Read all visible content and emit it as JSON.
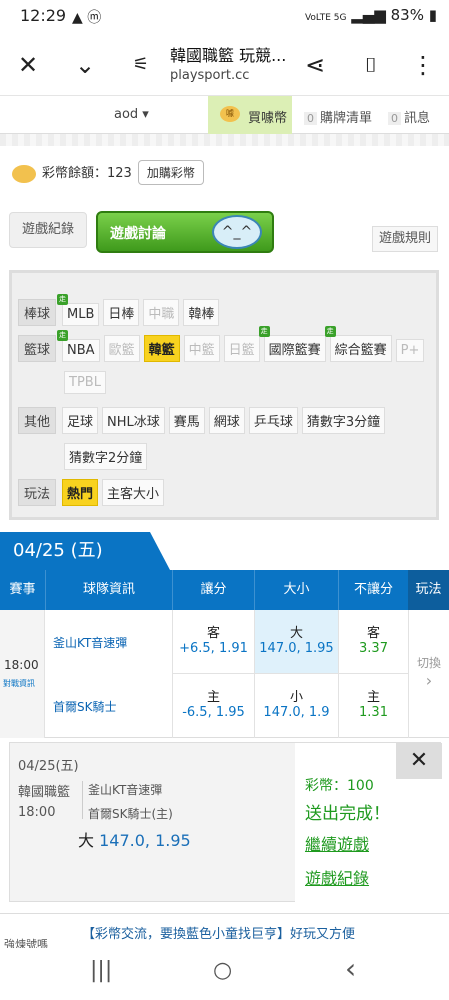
{
  "status": {
    "time": "12:29",
    "icons": "▲ ⓜ",
    "net": "VoLTE 5G",
    "battery": "83%"
  },
  "browser": {
    "title": "韓國職籃 玩競...",
    "url": "playsport.cc"
  },
  "nav": {
    "user": "aod ▾",
    "buy_label": "買噱幣",
    "buy_coin": "噱",
    "cart_count": "0",
    "cart_label": "購牌清單",
    "msg_count": "0",
    "msg_label": "訊息"
  },
  "balance": {
    "label": "彩幣餘額：123",
    "add_label": "加購彩幣"
  },
  "tabs": {
    "record": "遊戲紀錄",
    "discuss": "遊戲討論",
    "rules": "遊戲規則"
  },
  "filters": {
    "baseball": {
      "cat": "棒球",
      "items": [
        {
          "label": "MLB",
          "walk": true
        },
        {
          "label": "日棒"
        },
        {
          "label": "中職",
          "dim": true
        },
        {
          "label": "韓棒"
        }
      ]
    },
    "basketball": {
      "cat": "籃球",
      "items": [
        {
          "label": "NBA",
          "walk": true
        },
        {
          "label": "歐籃",
          "dim": true
        },
        {
          "label": "韓籃",
          "active": true
        },
        {
          "label": "中籃",
          "dim": true
        },
        {
          "label": "日籃",
          "dim": true
        },
        {
          "label": "國際籃賽",
          "walk": true
        },
        {
          "label": "綜合籃賽",
          "walk": true
        },
        {
          "label": "P+",
          "dim": true
        }
      ],
      "row2": [
        {
          "label": "TPBL",
          "dim": true
        }
      ]
    },
    "other": {
      "cat": "其他",
      "items": [
        {
          "label": "足球"
        },
        {
          "label": "NHL冰球"
        },
        {
          "label": "賽馬"
        },
        {
          "label": "網球"
        },
        {
          "label": "乒乓球"
        },
        {
          "label": "猜數字3分鐘"
        }
      ],
      "row2": [
        {
          "label": "猜數字2分鐘"
        }
      ]
    },
    "play": {
      "cat": "玩法",
      "items": [
        {
          "label": "熱門",
          "active": true
        },
        {
          "label": "主客大小"
        }
      ]
    },
    "walk_glyph": "走"
  },
  "date": "04/25 (五)",
  "table": {
    "headers": {
      "event": "賽事",
      "team": "球隊資訊",
      "spread": "讓分",
      "total": "大小",
      "moneyline": "不讓分",
      "play": "玩法"
    },
    "time": "18:00",
    "info": "對戰資訊",
    "away": {
      "team": "釜山KT音速彈",
      "spread_k": "客",
      "spread_v": "+6.5, 1.91",
      "total_k": "大",
      "total_v": "147.0, 1.95",
      "ml_k": "客",
      "ml_v": "3.37"
    },
    "home": {
      "team": "首爾SK騎士",
      "spread_k": "主",
      "spread_v": "-6.5, 1.95",
      "total_k": "小",
      "total_v": "147.0, 1.9",
      "ml_k": "主",
      "ml_v": "1.31"
    },
    "switch": "切換",
    "switch_arrow": "›"
  },
  "popup": {
    "date": "04/25(五)",
    "league": "韓國職籃",
    "time": "18:00",
    "away": "釜山KT音速彈",
    "home": "首爾SK騎士(主)",
    "bet_k": "大",
    "bet_v": "147.0, 1.95",
    "coins": "彩幣：100",
    "done": "送出完成！",
    "continue": "繼續遊戲",
    "record": "遊戲紀錄",
    "close": "✕"
  },
  "banner": {
    "text": "【彩幣交流，要換藍色小童找巨亨】好玩又方便",
    "left": "強煉號嗎"
  },
  "android": {
    "recent": "|||",
    "home": "○",
    "back": "‹"
  }
}
